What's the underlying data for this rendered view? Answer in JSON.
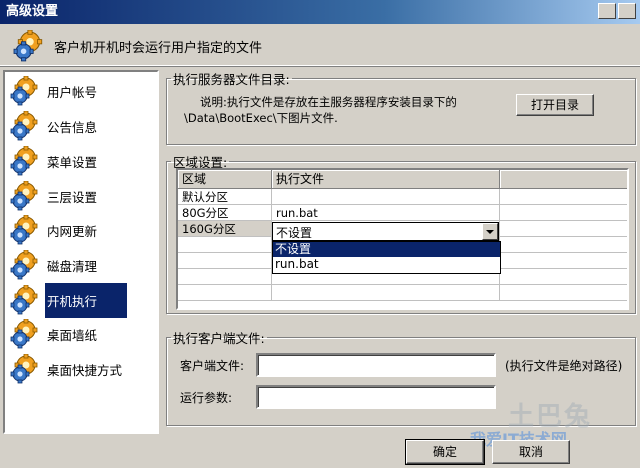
{
  "window": {
    "title": "高级设置"
  },
  "header": {
    "text": "客户机开机时会运行用户指定的文件"
  },
  "sidebar": {
    "items": [
      {
        "label": "用户帐号",
        "active": false
      },
      {
        "label": "公告信息",
        "active": false
      },
      {
        "label": "菜单设置",
        "active": false
      },
      {
        "label": "三层设置",
        "active": false
      },
      {
        "label": "内网更新",
        "active": false
      },
      {
        "label": "磁盘清理",
        "active": false
      },
      {
        "label": "开机执行",
        "active": true
      },
      {
        "label": "桌面墙纸",
        "active": false
      },
      {
        "label": "桌面快捷方式",
        "active": false
      }
    ]
  },
  "server_group": {
    "legend": "执行服务器文件目录:",
    "note_line1": "说明:执行文件是存放在主服务器程序安装目录下的",
    "note_line2": "\\Data\\BootExec\\下图片文件.",
    "open_button": "打开目录"
  },
  "region_group": {
    "legend": "区域设置:",
    "columns": [
      "区域",
      "执行文件"
    ],
    "rows": [
      {
        "region": "默认分区",
        "file": ""
      },
      {
        "region": "80G分区",
        "file": "run.bat"
      },
      {
        "region": "160G分区",
        "file": ""
      }
    ],
    "dropdown": {
      "value": "不设置",
      "options": [
        "不设置",
        "run.bat"
      ]
    }
  },
  "client_group": {
    "legend": "执行客户端文件:",
    "client_file_label": "客户端文件:",
    "client_file_value": "",
    "client_file_hint": "(执行文件是绝对路径)",
    "params_label": "运行参数:",
    "params_value": ""
  },
  "footer": {
    "ok": "确定",
    "cancel": "取消"
  },
  "watermark": {
    "text1": "土巴兔",
    "text2": "我爱IT技术网"
  },
  "colors": {
    "titlebar": "#0a246a",
    "face": "#d4d0c8",
    "selection": "#0a246a"
  }
}
